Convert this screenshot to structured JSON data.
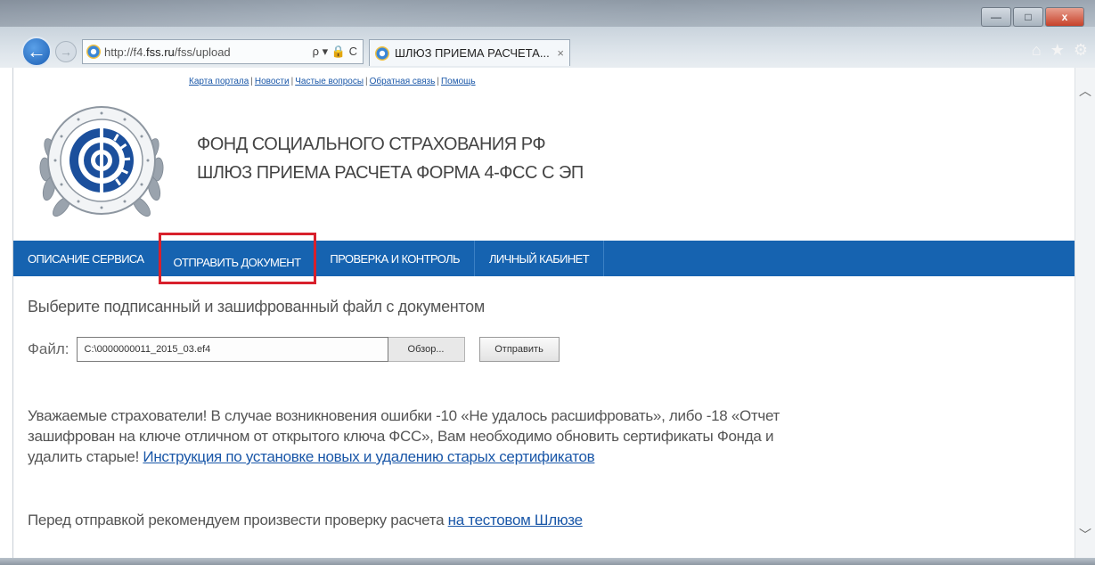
{
  "browser": {
    "url_prefix": "http://f4.",
    "url_domain": "fss.ru",
    "url_path": "/fss/upload",
    "address_tools": "ρ ▾ 🔒 C",
    "tab_title": "ШЛЮЗ ПРИЕМА РАСЧЕТА...",
    "tab_close": "×",
    "back": "←",
    "forward": "→",
    "home_icon": "⌂",
    "favorites_icon": "★",
    "settings_icon": "⚙",
    "min": "—",
    "max": "□",
    "close": "x"
  },
  "top_links": {
    "map": "Карта портала",
    "news": "Новости",
    "faq": "Частые вопросы",
    "feedback": "Обратная связь",
    "help": "Помощь",
    "separator": "|"
  },
  "header": {
    "org_line1": "ФОНД СОЦИАЛЬНОГО СТРАХОВАНИЯ РФ",
    "org_line2": "ШЛЮЗ ПРИЕМА РАСЧЕТА ФОРМА 4-ФСС С ЭП"
  },
  "nav": {
    "items": [
      {
        "label": "ОПИСАНИЕ СЕРВИСА"
      },
      {
        "label": "ОТПРАВИТЬ ДОКУМЕНТ"
      },
      {
        "label": "ПРОВЕРКА И КОНТРОЛЬ"
      },
      {
        "label": "ЛИЧНЫЙ КАБИНЕТ"
      }
    ],
    "active_index": 1
  },
  "upload": {
    "instruction": "Выберите подписанный и зашифрованный файл с документом",
    "file_label": "Файл:",
    "file_value": "C:\\0000000011_2015_03.ef4",
    "browse_label": "Обзор...",
    "send_label": "Отправить"
  },
  "notice": {
    "text": "Уважаемые страхователи! В случае возникновения ошибки -10 «Не удалось расшифровать», либо -18 «Отчет зашифрован на ключе отличном от открытого ключа ФСС», Вам необходимо обновить сертификаты Фонда и удалить старые! ",
    "link": "Инструкция по установке новых и удалению старых сертификатов"
  },
  "pre_check": {
    "text": "Перед отправкой рекомендуем произвести проверку расчета ",
    "link": "на тестовом Шлюзе"
  },
  "colors": {
    "nav_bg": "#1663b0",
    "active_outline": "#d8202c",
    "link": "#1a57a8"
  }
}
